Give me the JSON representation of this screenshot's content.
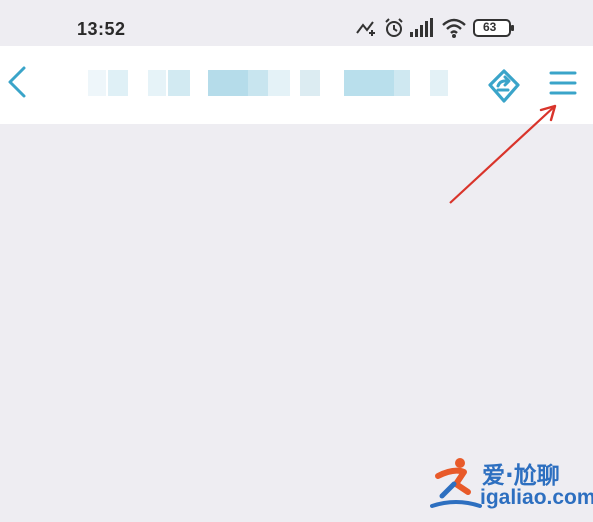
{
  "status_bar": {
    "time": "13:52",
    "battery": "63",
    "icons": [
      "data-speed-icon",
      "alarm-icon",
      "signal-icon",
      "wifi-icon",
      "battery-icon"
    ]
  },
  "nav": {
    "back_icon": "chevron-left-icon",
    "share_icon": "share-icon",
    "menu_icon": "hamburger-menu-icon",
    "accent_color": "#3aa4c9"
  },
  "watermark": {
    "cn": "爱·尬聊",
    "en": "igaliao.com"
  },
  "colors": {
    "background": "#eeedf2",
    "nav_background": "#ffffff",
    "arrow": "#d9342b"
  }
}
